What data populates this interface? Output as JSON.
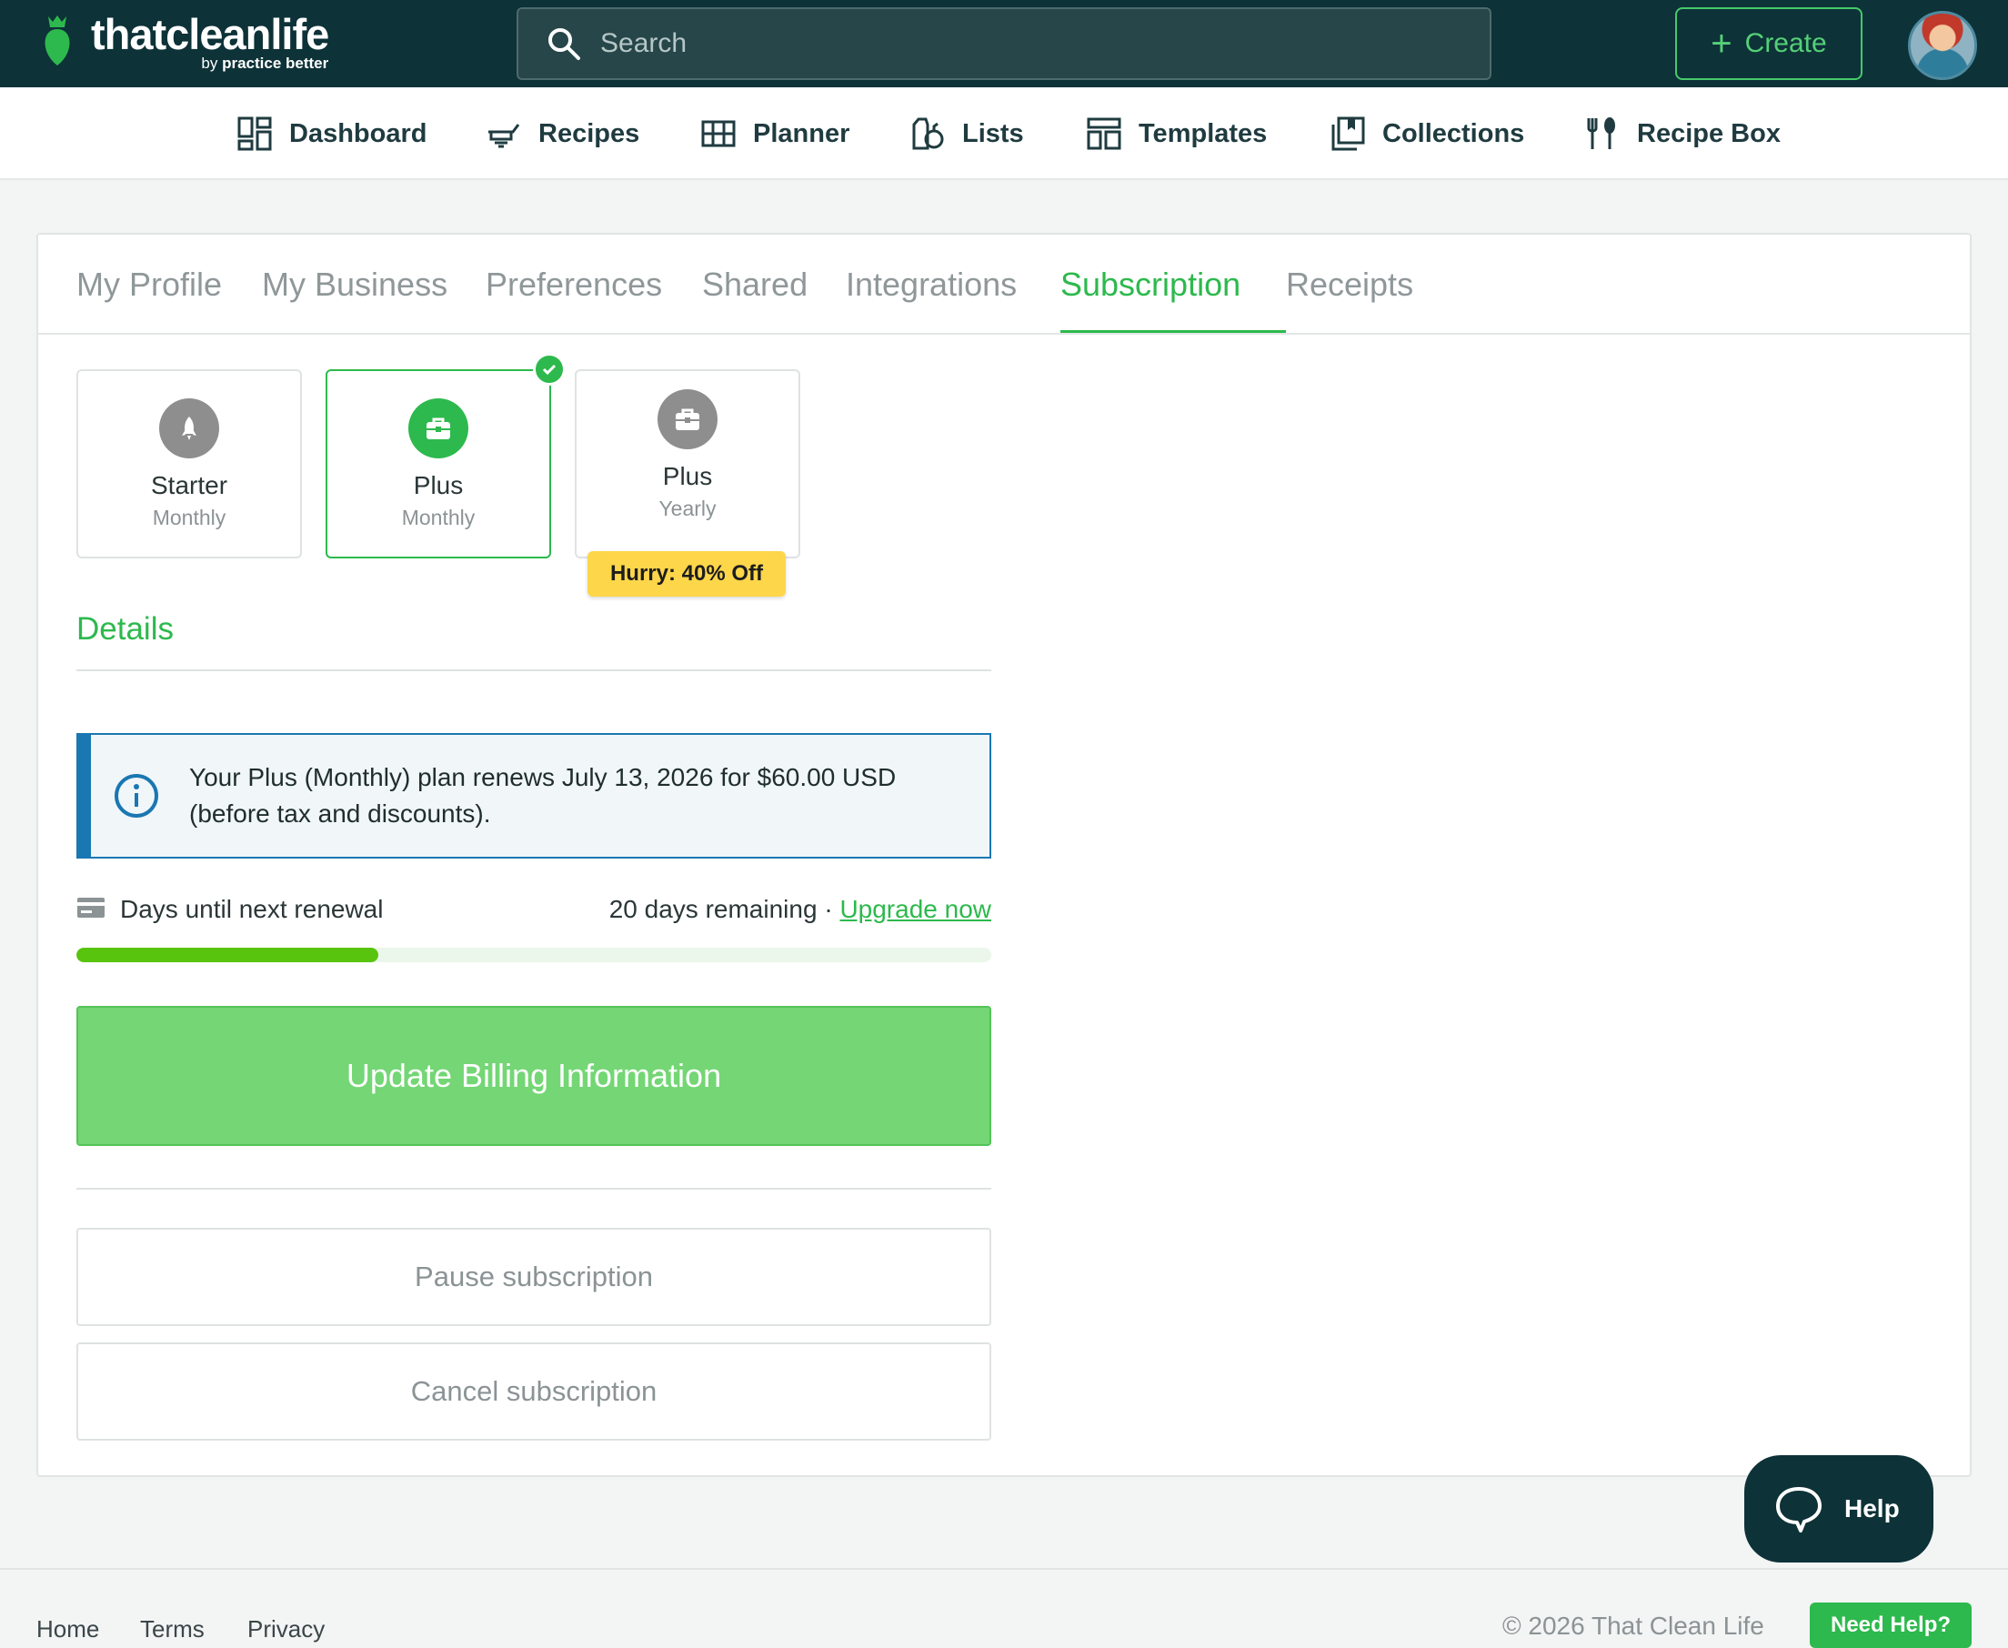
{
  "brand": {
    "name": "thatcleanlife",
    "by_prefix": "by",
    "by_name": "practice better",
    "accent_color": "#2db94d",
    "header_color": "#0d3238"
  },
  "header": {
    "search_placeholder": "Search",
    "create_label": "Create"
  },
  "nav": {
    "items": [
      {
        "label": "Dashboard",
        "icon": "dashboard-icon"
      },
      {
        "label": "Recipes",
        "icon": "recipes-icon"
      },
      {
        "label": "Planner",
        "icon": "planner-icon"
      },
      {
        "label": "Lists",
        "icon": "lists-icon"
      },
      {
        "label": "Templates",
        "icon": "templates-icon"
      },
      {
        "label": "Collections",
        "icon": "collections-icon"
      },
      {
        "label": "Recipe Box",
        "icon": "fork-spoon-icon"
      }
    ]
  },
  "tabs": [
    "My Profile",
    "My Business",
    "Preferences",
    "Shared",
    "Integrations",
    "Subscription",
    "Receipts"
  ],
  "active_tab": "Subscription",
  "plans": [
    {
      "name": "Starter",
      "period": "Monthly",
      "icon": "rocket-icon",
      "selected": false
    },
    {
      "name": "Plus",
      "period": "Monthly",
      "icon": "briefcase-icon",
      "selected": true
    },
    {
      "name": "Plus",
      "period": "Yearly",
      "icon": "briefcase-icon",
      "selected": false,
      "badge": "Hurry: 40% Off"
    }
  ],
  "details": {
    "title": "Details",
    "info": "Your Plus (Monthly) plan renews July 13, 2026 for $60.00 USD (before tax and discounts).",
    "renewal_label": "Days until next renewal",
    "remaining": "20 days remaining",
    "separator": "·",
    "upgrade_label": "Upgrade now",
    "progress_fraction": 0.33
  },
  "actions": {
    "update_billing": "Update Billing Information",
    "pause": "Pause subscription",
    "cancel": "Cancel subscription"
  },
  "help": {
    "label": "Help"
  },
  "footer": {
    "links": [
      "Home",
      "Terms",
      "Privacy"
    ],
    "copyright": "© 2026 That Clean Life",
    "need_help": "Need Help?"
  }
}
